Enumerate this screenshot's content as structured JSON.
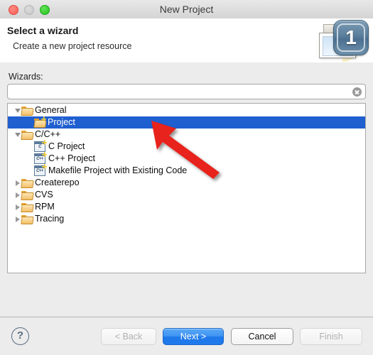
{
  "window": {
    "title": "New Project",
    "traffic_lights": [
      "close-red",
      "minimize-gray",
      "zoom-green"
    ]
  },
  "header": {
    "title": "Select a wizard",
    "subtitle": "Create a new project resource",
    "badge_number": "1",
    "wizard_icon": "new-project-wizard-icon"
  },
  "main": {
    "field_label": "Wizards:",
    "filter_value": "",
    "filter_placeholder": "",
    "clear_icon": "clear-circle-icon",
    "tree": [
      {
        "label": "General",
        "icon": "folder-open-icon",
        "indent": 0,
        "twisty": "open",
        "selected": false
      },
      {
        "label": "Project",
        "icon": "project-folder-icon",
        "indent": 1,
        "twisty": "none",
        "selected": true
      },
      {
        "label": "C/C++",
        "icon": "folder-open-icon",
        "indent": 0,
        "twisty": "open",
        "selected": false
      },
      {
        "label": "C Project",
        "icon": "c-project-icon",
        "indent": 1,
        "twisty": "none",
        "selected": false,
        "code": "C"
      },
      {
        "label": "C++ Project",
        "icon": "cpp-project-icon",
        "indent": 1,
        "twisty": "none",
        "selected": false,
        "code": "C++"
      },
      {
        "label": "Makefile Project with Existing Code",
        "icon": "cpp-project-icon",
        "indent": 1,
        "twisty": "none",
        "selected": false,
        "code": "C++"
      },
      {
        "label": "Createrepo",
        "icon": "folder-closed-icon",
        "indent": 0,
        "twisty": "closed",
        "selected": false
      },
      {
        "label": "CVS",
        "icon": "folder-closed-icon",
        "indent": 0,
        "twisty": "closed",
        "selected": false
      },
      {
        "label": "RPM",
        "icon": "folder-closed-icon",
        "indent": 0,
        "twisty": "closed",
        "selected": false
      },
      {
        "label": "Tracing",
        "icon": "folder-closed-icon",
        "indent": 0,
        "twisty": "closed",
        "selected": false
      }
    ]
  },
  "annotation": {
    "arrow": "red-pointer-arrow",
    "arrow_color": "#e8241a"
  },
  "footer": {
    "help_label": "?",
    "back_label": "< Back",
    "next_label": "Next >",
    "cancel_label": "Cancel",
    "finish_label": "Finish"
  },
  "colors": {
    "selection_blue": "#1f5fd0",
    "primary_button_blue": "#1f79ea",
    "window_background": "#ececec",
    "arrow_red": "#e8241a"
  }
}
